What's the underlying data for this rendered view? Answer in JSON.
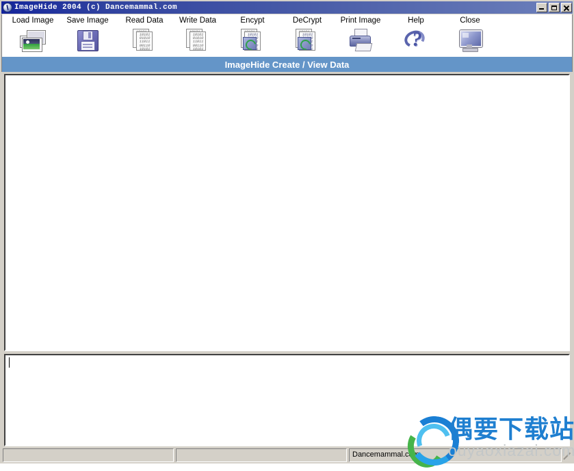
{
  "window": {
    "title": "ImageHide 2004 (c) Dancemammal.com",
    "icon": "app-logo-icon",
    "controls": {
      "minimize": "_",
      "maximize": "□",
      "close": "✕"
    }
  },
  "toolbar": {
    "items": [
      {
        "label": "Load Image",
        "icon": "photos-icon"
      },
      {
        "label": "Save Image",
        "icon": "floppy-disk-icon"
      },
      {
        "label": "Read Data",
        "icon": "binary-page-icon"
      },
      {
        "label": "Write Data",
        "icon": "binary-page-icon"
      },
      {
        "label": "Encypt",
        "icon": "encrypt-binary-icon"
      },
      {
        "label": "DeCrypt",
        "icon": "decrypt-binary-icon"
      },
      {
        "label": "Print Image",
        "icon": "printer-icon"
      },
      {
        "label": "Help",
        "icon": "question-mark-icon"
      },
      {
        "label": "Close",
        "icon": "monitor-icon"
      }
    ]
  },
  "banner": {
    "title": "ImageHide Create / View Data"
  },
  "image_panel": {
    "content": ""
  },
  "data_panel": {
    "value": "",
    "placeholder": ""
  },
  "status_bar": {
    "panes": [
      "",
      "",
      "Dancemammal.com"
    ]
  },
  "watermark": {
    "chinese": "偶要下载站",
    "english": "ouyaoxiazai.com",
    "logo": "swirl-logo-icon"
  },
  "colors": {
    "banner_blue": "#6495c8",
    "title_bar_start": "#14259c",
    "title_bar_end": "#6d80bb",
    "window_face": "#d4d0c8",
    "watermark_blue": "#1f7fd0",
    "watermark_green": "#46b44a",
    "watermark_grey": "#c3c7c8"
  }
}
